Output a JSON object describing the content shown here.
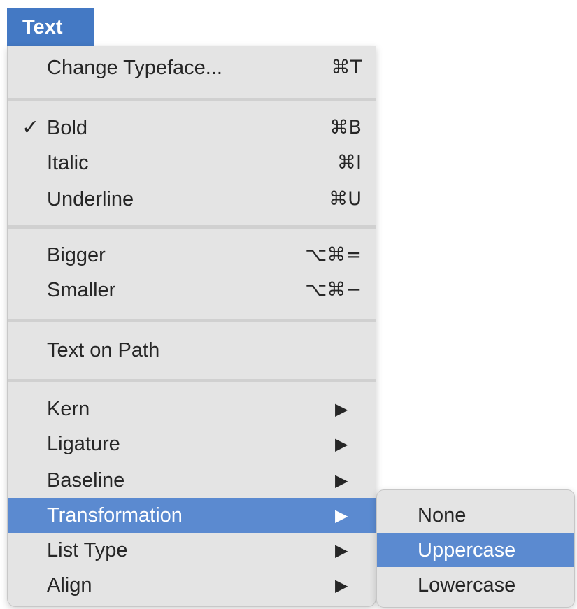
{
  "menubar": {
    "title": "Text"
  },
  "menu": {
    "items": [
      {
        "label": "Change Typeface...",
        "shortcut": "⌘T",
        "checked": false,
        "submenu": false
      },
      {
        "label": "Bold",
        "shortcut": "⌘B",
        "checked": true,
        "submenu": false
      },
      {
        "label": "Italic",
        "shortcut": "⌘I",
        "checked": false,
        "submenu": false
      },
      {
        "label": "Underline",
        "shortcut": "⌘U",
        "checked": false,
        "submenu": false
      },
      {
        "label": "Bigger",
        "shortcut": "⌥⌘=",
        "checked": false,
        "submenu": false
      },
      {
        "label": "Smaller",
        "shortcut": "⌥⌘−",
        "checked": false,
        "submenu": false
      },
      {
        "label": "Text on Path",
        "shortcut": "",
        "checked": false,
        "submenu": false
      },
      {
        "label": "Kern",
        "shortcut": "",
        "checked": false,
        "submenu": true
      },
      {
        "label": "Ligature",
        "shortcut": "",
        "checked": false,
        "submenu": true
      },
      {
        "label": "Baseline",
        "shortcut": "",
        "checked": false,
        "submenu": true
      },
      {
        "label": "Transformation",
        "shortcut": "",
        "checked": false,
        "submenu": true,
        "highlighted": true
      },
      {
        "label": "List Type",
        "shortcut": "",
        "checked": false,
        "submenu": true
      },
      {
        "label": "Align",
        "shortcut": "",
        "checked": false,
        "submenu": true
      }
    ],
    "check_glyph": "✓",
    "arrow_glyph": "▶"
  },
  "submenu": {
    "items": [
      {
        "label": "None"
      },
      {
        "label": "Uppercase",
        "highlighted": true
      },
      {
        "label": "Lowercase"
      }
    ]
  },
  "colors": {
    "highlight": "#5b8ad0",
    "menubar_active": "#4479c4",
    "menu_background": "#e4e4e4"
  }
}
